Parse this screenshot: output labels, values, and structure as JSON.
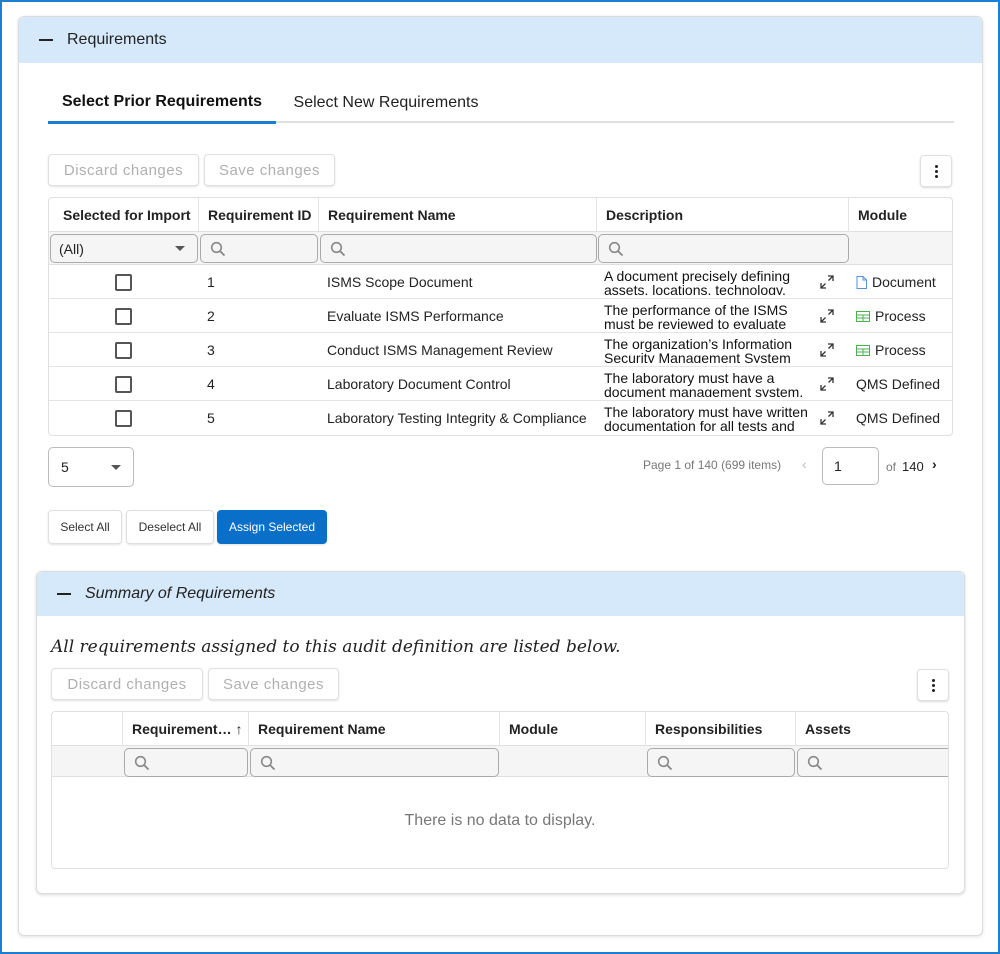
{
  "requirements_panel": {
    "title": "Requirements",
    "tabs": [
      {
        "label": "Select Prior Requirements",
        "active": true
      },
      {
        "label": "Select New Requirements",
        "active": false
      }
    ],
    "toolbar": {
      "discard_label": "Discard changes",
      "save_label": "Save changes"
    },
    "grid": {
      "columns": [
        "Selected for Import",
        "Requirement ID",
        "Requirement Name",
        "Description",
        "Module"
      ],
      "filter_select_value": "(All)",
      "rows": [
        {
          "id": "1",
          "name": "ISMS Scope Document",
          "description": "A document precisely defining assets, locations, technology,",
          "module": "Document",
          "module_icon": "document-icon"
        },
        {
          "id": "2",
          "name": "Evaluate ISMS Performance",
          "description": "The performance of the ISMS must be reviewed to evaluate",
          "module": "Process",
          "module_icon": "process-icon"
        },
        {
          "id": "3",
          "name": "Conduct ISMS Management Review",
          "description": "The organization’s Information Security Management System",
          "module": "Process",
          "module_icon": "process-icon"
        },
        {
          "id": "4",
          "name": "Laboratory Document Control",
          "description": "The laboratory must have a document management system.",
          "module": "QMS Defined",
          "module_icon": ""
        },
        {
          "id": "5",
          "name": "Laboratory Testing Integrity & Compliance",
          "description": "The laboratory must have written documentation for all tests and",
          "module": "QMS Defined",
          "module_icon": ""
        }
      ]
    },
    "pager": {
      "page_size": "5",
      "info": "Page 1 of 140 (699 items)",
      "current_page": "1",
      "of_label": "of",
      "total_pages": "140"
    },
    "actions": {
      "select_all": "Select All",
      "deselect_all": "Deselect All",
      "assign_selected": "Assign Selected"
    }
  },
  "summary_panel": {
    "title": "Summary of Requirements",
    "description": "All requirements assigned to this audit definition are listed below.",
    "toolbar": {
      "discard_label": "Discard changes",
      "save_label": "Save changes"
    },
    "grid": {
      "columns": [
        "",
        "Requirement… ↑",
        "Requirement Name",
        "Module",
        "Responsibilities",
        "Assets"
      ],
      "empty_text": "There is no data to display."
    }
  },
  "colors": {
    "accent": "#1a7fd4",
    "header_bg": "#d5e9fb",
    "primary_button": "#0a6fc9",
    "process_icon": "#4caf50",
    "document_icon": "#5b8fd6"
  }
}
